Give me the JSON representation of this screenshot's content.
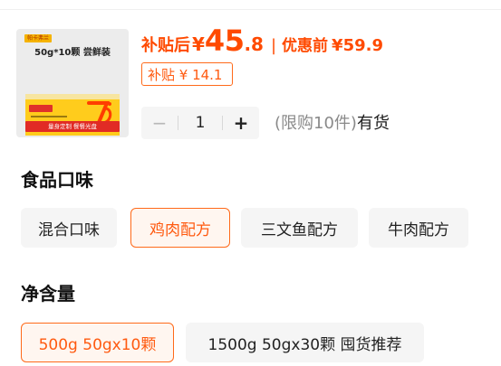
{
  "product": {
    "thumbnail": {
      "brand_tag": "帕卡弗兰",
      "pack_title": "50g*10颗 尝鲜装",
      "banner": "量身定制 餐餐光盘"
    },
    "price": {
      "subsidy_label": "补贴后",
      "currency": "¥",
      "integer": "45",
      "decimal": ".8",
      "separator": "|",
      "original_label": "优惠前",
      "original_price": "¥59.9",
      "subsidy_badge": "补贴 ¥ 14.1"
    },
    "quantity": {
      "minus": "−",
      "value": "1",
      "plus": "+",
      "limit_text": "(限购10件)",
      "stock_status": "有货"
    }
  },
  "flavor": {
    "title": "食品口味",
    "options": [
      "混合口味",
      "鸡肉配方",
      "三文鱼配方",
      "牛肉配方"
    ],
    "selected": "鸡肉配方"
  },
  "weight": {
    "title": "净含量",
    "options": [
      "500g 50gx10颗",
      "1500g 50gx30颗 囤货推荐"
    ],
    "selected": "500g 50gx10颗"
  },
  "colors": {
    "accent": "#ff4a00",
    "chip_bg": "#f5f5f5",
    "selected_border": "#ff6a1a"
  }
}
